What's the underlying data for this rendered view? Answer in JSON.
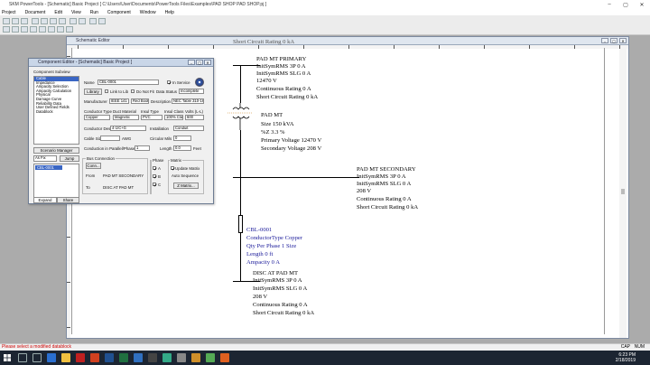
{
  "window": {
    "title": "SKM PowerTools - [Schematic] Basic Project [ C:\\Users\\User\\Documents\\PowerTools Files\\Examples\\PAD SHOP PAD SHOP.pj ]",
    "minimize": "–",
    "maximize": "▢",
    "close": "✕"
  },
  "menu": [
    "Project",
    "Document",
    "Edit",
    "View",
    "Run",
    "Component",
    "Window",
    "Help"
  ],
  "doc": {
    "title": "Schematic Editor",
    "partial_top_text": "Short Circuit Rating 0 kA"
  },
  "schematic": {
    "primary": [
      "PAD MT PRIMARY",
      "InitSymRMS 3P 0 A",
      "InitSymRMS SLG 0 A",
      "12470 V",
      "Continuous Rating 0 A",
      "Short Circuit Rating 0 kA"
    ],
    "transformer": [
      "PAD MT",
      "Size 150 kVA",
      "%Z 3.3 %",
      "Primary Voltage 12470 V",
      "Secondary Voltage 208 V"
    ],
    "secondary": [
      "PAD MT SECONDARY",
      "InitSymRMS 3P 0 A",
      "InitSymRMS SLG 0 A",
      "208 V",
      "Continuous Rating 0 A",
      "Short Circuit Rating 0 kA"
    ],
    "cable": [
      "CBL-0001",
      "ConductorType Copper",
      "Qty Per Phase 1   Size",
      "Length 0 ft",
      "Ampacity 0 A"
    ],
    "disc": [
      "DISC AT PAD MT",
      "InitSymRMS 3P 0 A",
      "InitSymRMS SLG 0 A",
      "208 V",
      "Continuous Rating 0 A",
      "Short Circuit Rating 0 kA"
    ]
  },
  "dialog": {
    "title": "Component Editor - [Schematic] Basic Project ]",
    "subview_label": "Component Subview",
    "subviews": [
      "Cable",
      "Impedance",
      "Ampacity Selection",
      "Ampacity Calculation",
      "Physical",
      "Damage Curve",
      "Reliability Data",
      "User Defined Fields",
      "Datablock"
    ],
    "scenario_manager": "Scenario Manager",
    "as_fix": "As Fix",
    "jump": "Jump",
    "tree_item": "CBL-0001",
    "tab_expand": "Expand",
    "tab_share": "Share",
    "name_label": "Name",
    "name_value": "CBL-0001",
    "in_service": "In Service",
    "library_btn": "Library",
    "link_to_lib": "Link to Lib",
    "do_not_fit": "Do Not Fit",
    "data_status_label": "Data Status",
    "data_status_value": "Incomplete",
    "manufacturer_label": "Manufacturer",
    "manufacturer_value": "IEEE 141",
    "code_value": "Red Book",
    "description_label": "Description",
    "description_value": "NEC Table 310-16",
    "conductor_type_label": "Conductor Type",
    "conductor_type_value": "Copper",
    "duct_material_label": "Duct Material",
    "duct_material_value": "Magnetic",
    "insul_type_label": "Insul Type",
    "insul_type_value": "PVC",
    "insul_class_label": "Insul Class",
    "insul_class_value": "100% Class",
    "volts_label": "Volts (L-L)",
    "volts_value": "600",
    "conductor_desc_label": "Conductor Desc.",
    "conductor_desc_value": "4-1/C+G",
    "installation_label": "Installation",
    "installation_value": "Conduit",
    "cable_size_label": "Cable Size",
    "awg_label": "AWG",
    "circular_mils_label": "Circular Mils",
    "circular_mils_value": "0",
    "conduction_label": "Conduction in Parallel/Phase",
    "conduction_value": "1",
    "length_label": "Length",
    "length_value": "0.0",
    "length_unit": "Feet",
    "bus_connection_label": "Bus Connection",
    "conn_btn": "Conn...",
    "from_label": "From",
    "from_value": "PAD MT SECONDARY",
    "to_label": "To",
    "to_value": "DISC AT PAD MT",
    "phase_label": "Phase",
    "phase_a": "A",
    "phase_b": "B",
    "phase_c": "C",
    "matrix_label": "Matrix",
    "update_matrix": "Update Matrix",
    "auto_sequence": "Auto Sequence",
    "z_matrix_btn": "Z Matrix..."
  },
  "status": {
    "message": "Please select a modified datablock",
    "caps": "CAP",
    "num": "NUM"
  },
  "taskbar": {
    "time": "6:23 PM",
    "date": "2/18/2019"
  },
  "colors": {
    "selection": "#3a66c4",
    "cable_text": "#1a1a9a",
    "taskbar": "#1c2532"
  }
}
